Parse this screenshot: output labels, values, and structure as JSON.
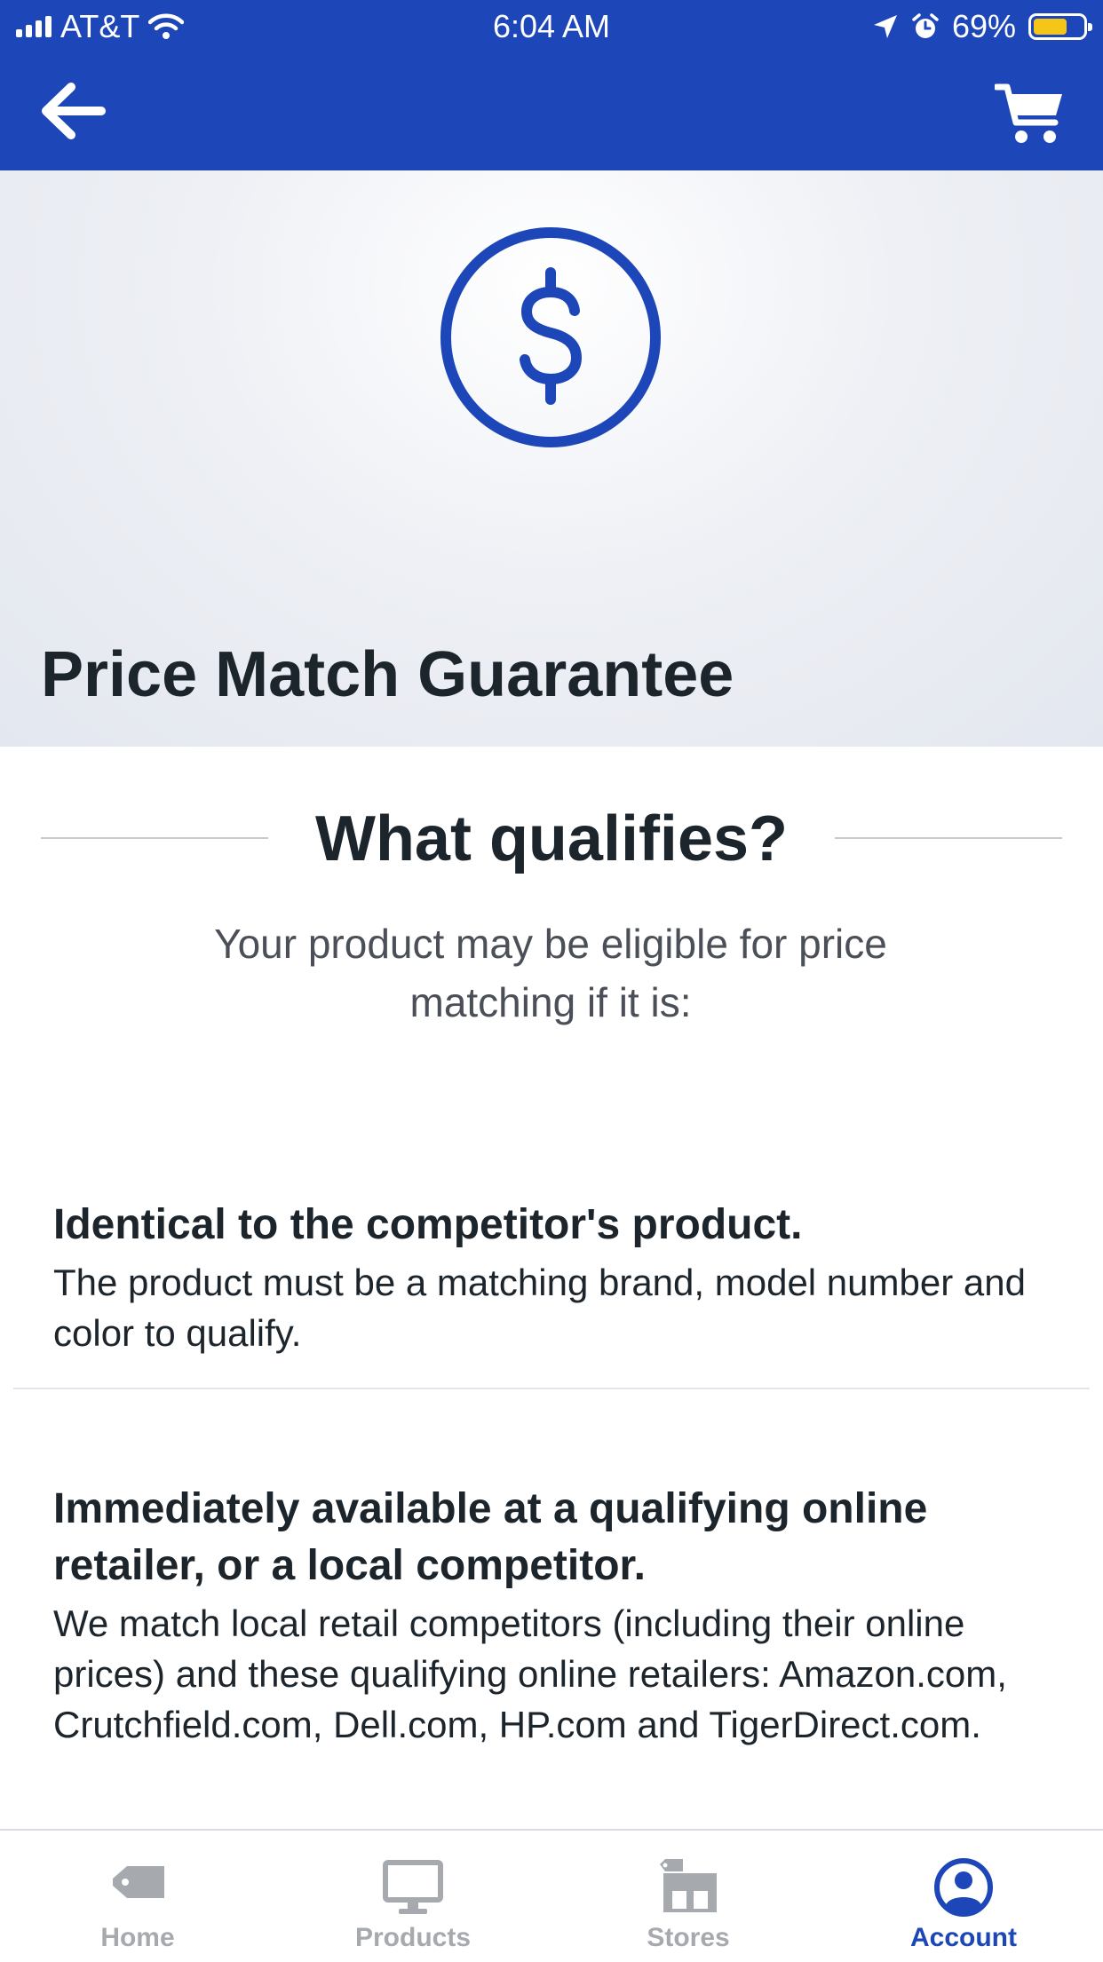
{
  "status_bar": {
    "carrier": "AT&T",
    "time": "6:04 AM",
    "battery_percent": "69%",
    "battery_level": 0.69
  },
  "nav": {
    "back_icon": "back-arrow-icon",
    "cart_icon": "cart-icon"
  },
  "hero": {
    "icon": "dollar-circle-icon",
    "title": "Price Match Guarantee"
  },
  "section": {
    "heading": "What qualifies?",
    "intro": "Your product may be eligible for price matching if it is:"
  },
  "items": [
    {
      "title": "Identical to the competitor's product.",
      "body": "The product must be a matching brand, model number and color to qualify."
    },
    {
      "title": "Immediately available at a qualifying online retailer, or a local competitor.",
      "body": "We match local retail competitors (including their online prices) and these qualifying online retailers: Amazon.com, Crutchfield.com, Dell.com, HP.com and TigerDirect.com."
    }
  ],
  "tabs": [
    {
      "label": "Home",
      "icon": "tag-icon",
      "active": false
    },
    {
      "label": "Products",
      "icon": "monitor-icon",
      "active": false
    },
    {
      "label": "Stores",
      "icon": "store-icon",
      "active": false
    },
    {
      "label": "Account",
      "icon": "account-icon",
      "active": true
    }
  ],
  "colors": {
    "brand_blue": "#1d46b8",
    "battery_yellow": "#f5c518",
    "text_dark": "#1d252c",
    "tab_inactive": "#a6a9ae"
  }
}
